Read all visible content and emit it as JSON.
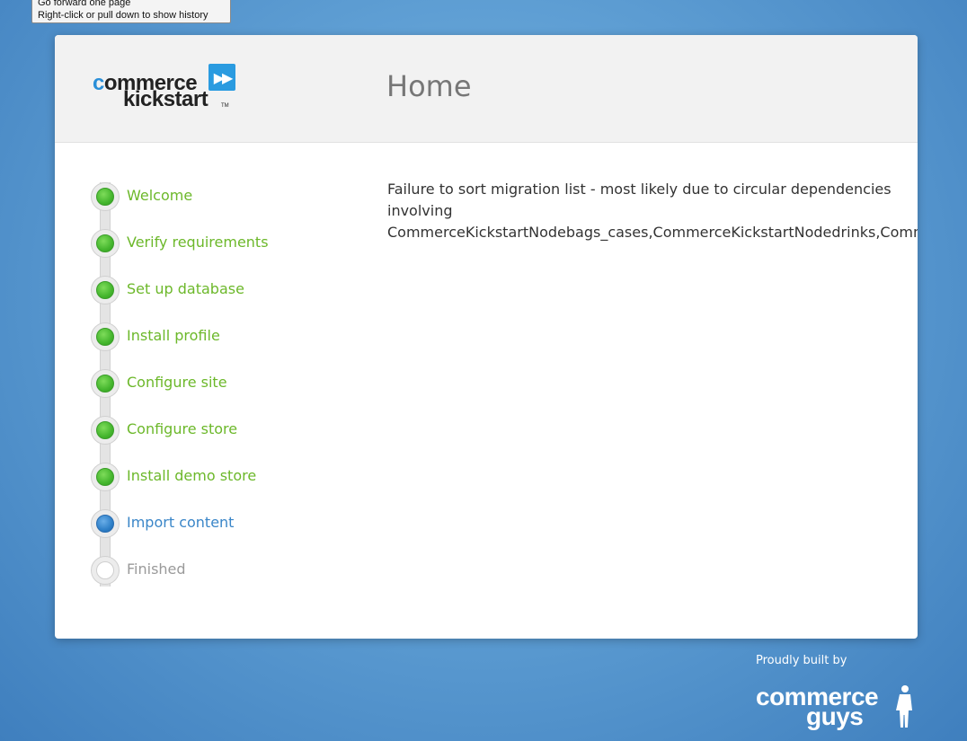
{
  "tooltip": {
    "line1": "Go forward one page",
    "line2": "Right-click or pull down to show history"
  },
  "header": {
    "logo_line1_o": "c",
    "logo_line1_rest": "ommerce",
    "logo_line2": "kickstart",
    "logo_tm": "TM",
    "logo_icon": "fast-forward-icon",
    "title": "Home"
  },
  "steps": [
    {
      "label": "Welcome",
      "state": "done"
    },
    {
      "label": "Verify requirements",
      "state": "done"
    },
    {
      "label": "Set up database",
      "state": "done"
    },
    {
      "label": "Install profile",
      "state": "done"
    },
    {
      "label": "Configure site",
      "state": "done"
    },
    {
      "label": "Configure store",
      "state": "done"
    },
    {
      "label": "Install demo store",
      "state": "done"
    },
    {
      "label": "Import content",
      "state": "active"
    },
    {
      "label": "Finished",
      "state": "pending"
    }
  ],
  "message": {
    "line1": "Failure to sort migration list - most likely due to circular dependencies",
    "line2": "involving",
    "line3": "CommerceKickstartNodebags_cases,CommerceKickstartNodedrinks,CommerceK"
  },
  "footer": {
    "built_by": "Proudly built by",
    "logo_line1": "commerce",
    "logo_line2": "guys"
  },
  "colors": {
    "done": "#45b62e",
    "active": "#2f80c8",
    "pending": "#ffffff",
    "background": "#5f9fd4"
  }
}
